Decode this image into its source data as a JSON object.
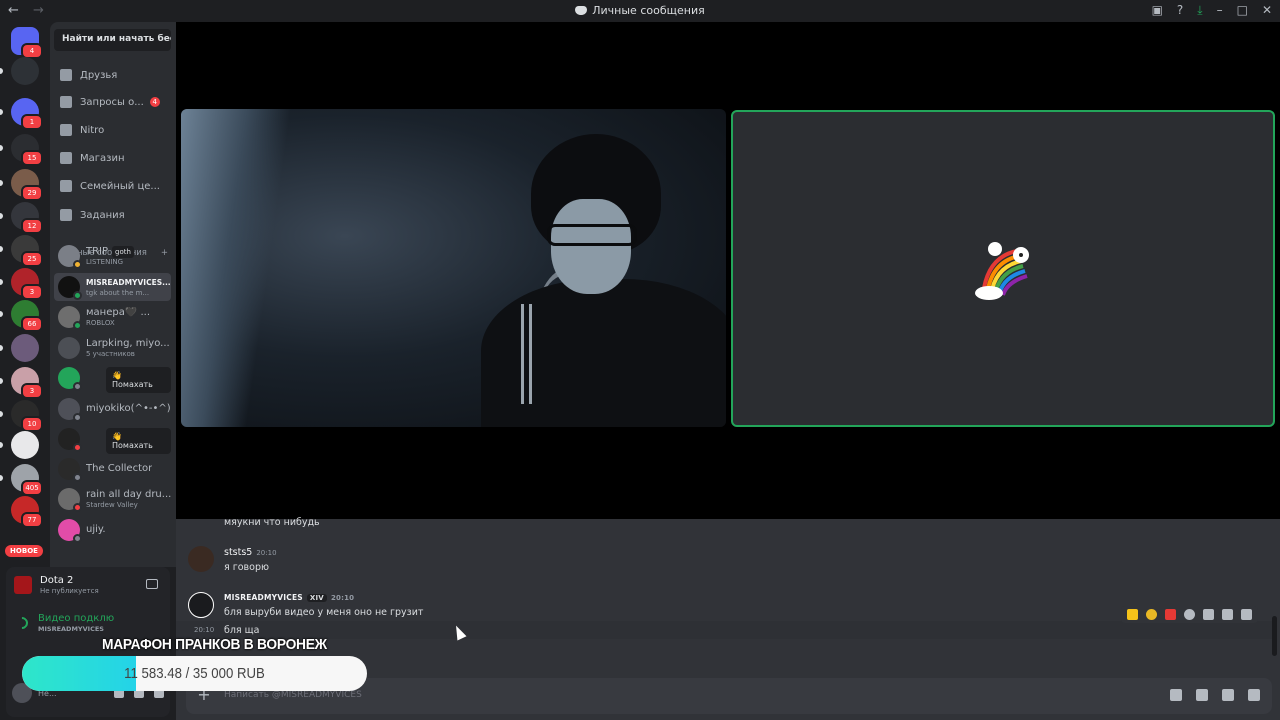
{
  "titlebar": {
    "title": "Личные сообщения",
    "back": "←",
    "forward": "→"
  },
  "colors": {
    "accent": "#5865f2",
    "online": "#23a55a",
    "badge": "#f23f43",
    "donation_fill": "#2ee6c9"
  },
  "servers": [
    {
      "name": "home",
      "badge": "4"
    },
    {
      "badge": ""
    },
    {
      "badge": "1"
    },
    {
      "badge": "15"
    },
    {
      "badge": "29"
    },
    {
      "badge": "12"
    },
    {
      "badge": "25"
    },
    {
      "badge": "3"
    },
    {
      "badge": "66"
    },
    {
      "badge": ""
    },
    {
      "badge": "3"
    },
    {
      "badge": "10"
    },
    {
      "badge": ""
    },
    {
      "badge": "405"
    },
    {
      "badge": "77"
    }
  ],
  "rail": {
    "new_label": "НОВОЕ"
  },
  "sidebar": {
    "search_placeholder": "Найти или начать бес...",
    "nav": [
      {
        "label": "Друзья",
        "icon": "friends-icon",
        "badge": ""
      },
      {
        "label": "Запросы о...",
        "icon": "inbox-icon",
        "badge": "4"
      },
      {
        "label": "Nitro",
        "icon": "nitro-icon",
        "badge": ""
      },
      {
        "label": "Магазин",
        "icon": "shop-icon",
        "badge": ""
      },
      {
        "label": "Семейный це...",
        "icon": "family-icon",
        "badge": ""
      },
      {
        "label": "Задания",
        "icon": "quests-icon",
        "badge": ""
      }
    ],
    "dm_header": "Личные сообщения",
    "dm_add": "+",
    "dms": [
      {
        "name": "TRIP",
        "tag": "goth",
        "sub": "LISTENING"
      },
      {
        "name": "MISREADMYVICES...",
        "sub": "tgk about the m..."
      },
      {
        "name": "манера🖤 ...",
        "sub": "ROBLOX"
      },
      {
        "name": "Larpking, miyo...",
        "sub": "5 участников"
      },
      {
        "name": "",
        "wave": "👋 Помахать"
      },
      {
        "name": "miyokiko(^•-•^)...",
        "sub": ""
      },
      {
        "name": "",
        "wave": "👋 Помахать"
      },
      {
        "name": "The Collector",
        "sub": ""
      },
      {
        "name": "rain all day dru...",
        "sub": "Stardew Valley"
      },
      {
        "name": "ujiy.",
        "sub": ""
      }
    ]
  },
  "panel": {
    "game_name": "Dota 2",
    "game_status": "Не публикуется",
    "voice_label": "Видео подклю",
    "voice_channel": "MISREADMYVICES",
    "user_status": "Не..."
  },
  "chat": {
    "messages": [
      {
        "text": "мяукни что нибудь"
      },
      {
        "author": "ststs5",
        "time": "20:10",
        "text": "я говорю"
      },
      {
        "author": "MISREADMYVICES",
        "tag": "XIV",
        "time": "20:10",
        "text": "бля выруби видео у меня оно не грузит"
      },
      {
        "time": "20:10",
        "text": "бля ща"
      }
    ],
    "composer_placeholder": "Написать @MISREADMYVICES"
  },
  "donation": {
    "title": "МАРАФОН ПРАНКОВ В ВОРОНЕЖ",
    "progress_text": "11 583.48 / 35 000 RUB",
    "raised": 11583.48,
    "goal": 35000
  }
}
